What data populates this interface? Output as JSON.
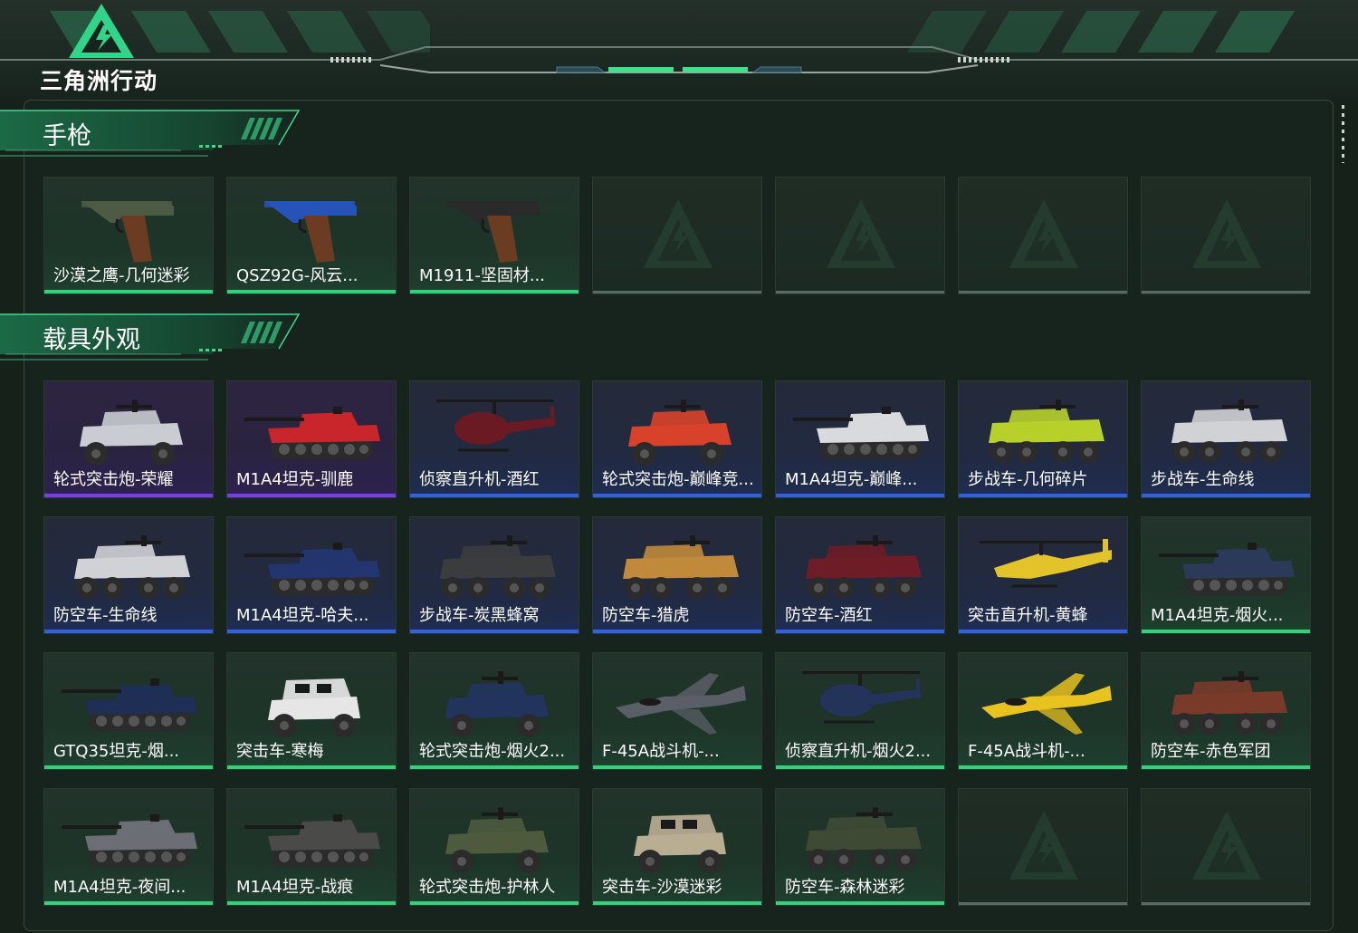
{
  "app": {
    "logo_text": "三角洲行动",
    "brand_color": "#2ed47a"
  },
  "sections": [
    {
      "title": "手枪",
      "items": [
        {
          "label": "沙漠之鹰-几何迷彩",
          "rarity": "green",
          "icon": "pistol-icon",
          "color": "#4d5a44"
        },
        {
          "label": "QSZ92G-风云...",
          "rarity": "green",
          "icon": "pistol-icon",
          "color": "#2753b8"
        },
        {
          "label": "M1911-坚固材...",
          "rarity": "green",
          "icon": "pistol-icon",
          "color": "#2a2a2a"
        },
        {
          "label": "",
          "rarity": "empty"
        },
        {
          "label": "",
          "rarity": "empty"
        },
        {
          "label": "",
          "rarity": "empty"
        },
        {
          "label": "",
          "rarity": "empty"
        }
      ]
    },
    {
      "title": "载具外观",
      "items": [
        {
          "label": "轮式突击炮-荣耀",
          "rarity": "purple",
          "icon": "armored-car-icon",
          "color": "#c9ccd2"
        },
        {
          "label": "M1A4坦克-驯鹿",
          "rarity": "purple",
          "icon": "tank-icon",
          "color": "#c8262a"
        },
        {
          "label": "侦察直升机-酒红",
          "rarity": "blue",
          "icon": "helicopter-icon",
          "color": "#6a1a22"
        },
        {
          "label": "轮式突击炮-巅峰竞...",
          "rarity": "blue",
          "icon": "armored-car-icon",
          "color": "#d8422a"
        },
        {
          "label": "M1A4坦克-巅峰...",
          "rarity": "blue",
          "icon": "tank-icon",
          "color": "#d9dadd"
        },
        {
          "label": "步战车-几何碎片",
          "rarity": "blue",
          "icon": "ifv-icon",
          "color": "#b7d12a"
        },
        {
          "label": "步战车-生命线",
          "rarity": "blue",
          "icon": "ifv-icon",
          "color": "#d0d2d6"
        },
        {
          "label": "防空车-生命线",
          "rarity": "blue",
          "icon": "ifv-icon",
          "color": "#d0d2d6"
        },
        {
          "label": "M1A4坦克-哈夫...",
          "rarity": "blue",
          "icon": "tank-icon",
          "color": "#23356e"
        },
        {
          "label": "步战车-炭黑蜂窝",
          "rarity": "blue",
          "icon": "ifv-icon",
          "color": "#3a3c3e"
        },
        {
          "label": "防空车-猎虎",
          "rarity": "blue",
          "icon": "ifv-icon",
          "color": "#c08a3a"
        },
        {
          "label": "防空车-酒红",
          "rarity": "blue",
          "icon": "ifv-icon",
          "color": "#6e1c25"
        },
        {
          "label": "突击直升机-黄蜂",
          "rarity": "blue",
          "icon": "attack-helicopter-icon",
          "color": "#e2c32a"
        },
        {
          "label": "M1A4坦克-烟火...",
          "rarity": "green",
          "icon": "tank-icon",
          "color": "#2a3a58"
        },
        {
          "label": "GTQ35坦克-烟...",
          "rarity": "green",
          "icon": "tank-icon",
          "color": "#1f2e55"
        },
        {
          "label": "突击车-寒梅",
          "rarity": "green",
          "icon": "assault-vehicle-icon",
          "color": "#e6e6e6"
        },
        {
          "label": "轮式突击炮-烟火2...",
          "rarity": "green",
          "icon": "armored-car-icon",
          "color": "#22345e"
        },
        {
          "label": "F-45A战斗机-...",
          "rarity": "green",
          "icon": "fighter-jet-icon",
          "color": "#5a5e66"
        },
        {
          "label": "侦察直升机-烟火2...",
          "rarity": "green",
          "icon": "helicopter-icon",
          "color": "#24335a"
        },
        {
          "label": "F-45A战斗机-...",
          "rarity": "green",
          "icon": "fighter-jet-icon",
          "color": "#e8c21e"
        },
        {
          "label": "防空车-赤色军团",
          "rarity": "green",
          "icon": "ifv-icon",
          "color": "#7a3a2a"
        },
        {
          "label": "M1A4坦克-夜间...",
          "rarity": "green",
          "icon": "tank-icon",
          "color": "#6b6f75"
        },
        {
          "label": "M1A4坦克-战痕",
          "rarity": "green",
          "icon": "tank-icon",
          "color": "#4a4a48"
        },
        {
          "label": "轮式突击炮-护林人",
          "rarity": "green",
          "icon": "armored-car-icon",
          "color": "#4d5a3e"
        },
        {
          "label": "突击车-沙漠迷彩",
          "rarity": "green",
          "icon": "assault-vehicle-icon",
          "color": "#b9ad92"
        },
        {
          "label": "防空车-森林迷彩",
          "rarity": "green",
          "icon": "ifv-icon",
          "color": "#3e4a34"
        },
        {
          "label": "",
          "rarity": "empty"
        },
        {
          "label": "",
          "rarity": "empty"
        }
      ]
    }
  ]
}
